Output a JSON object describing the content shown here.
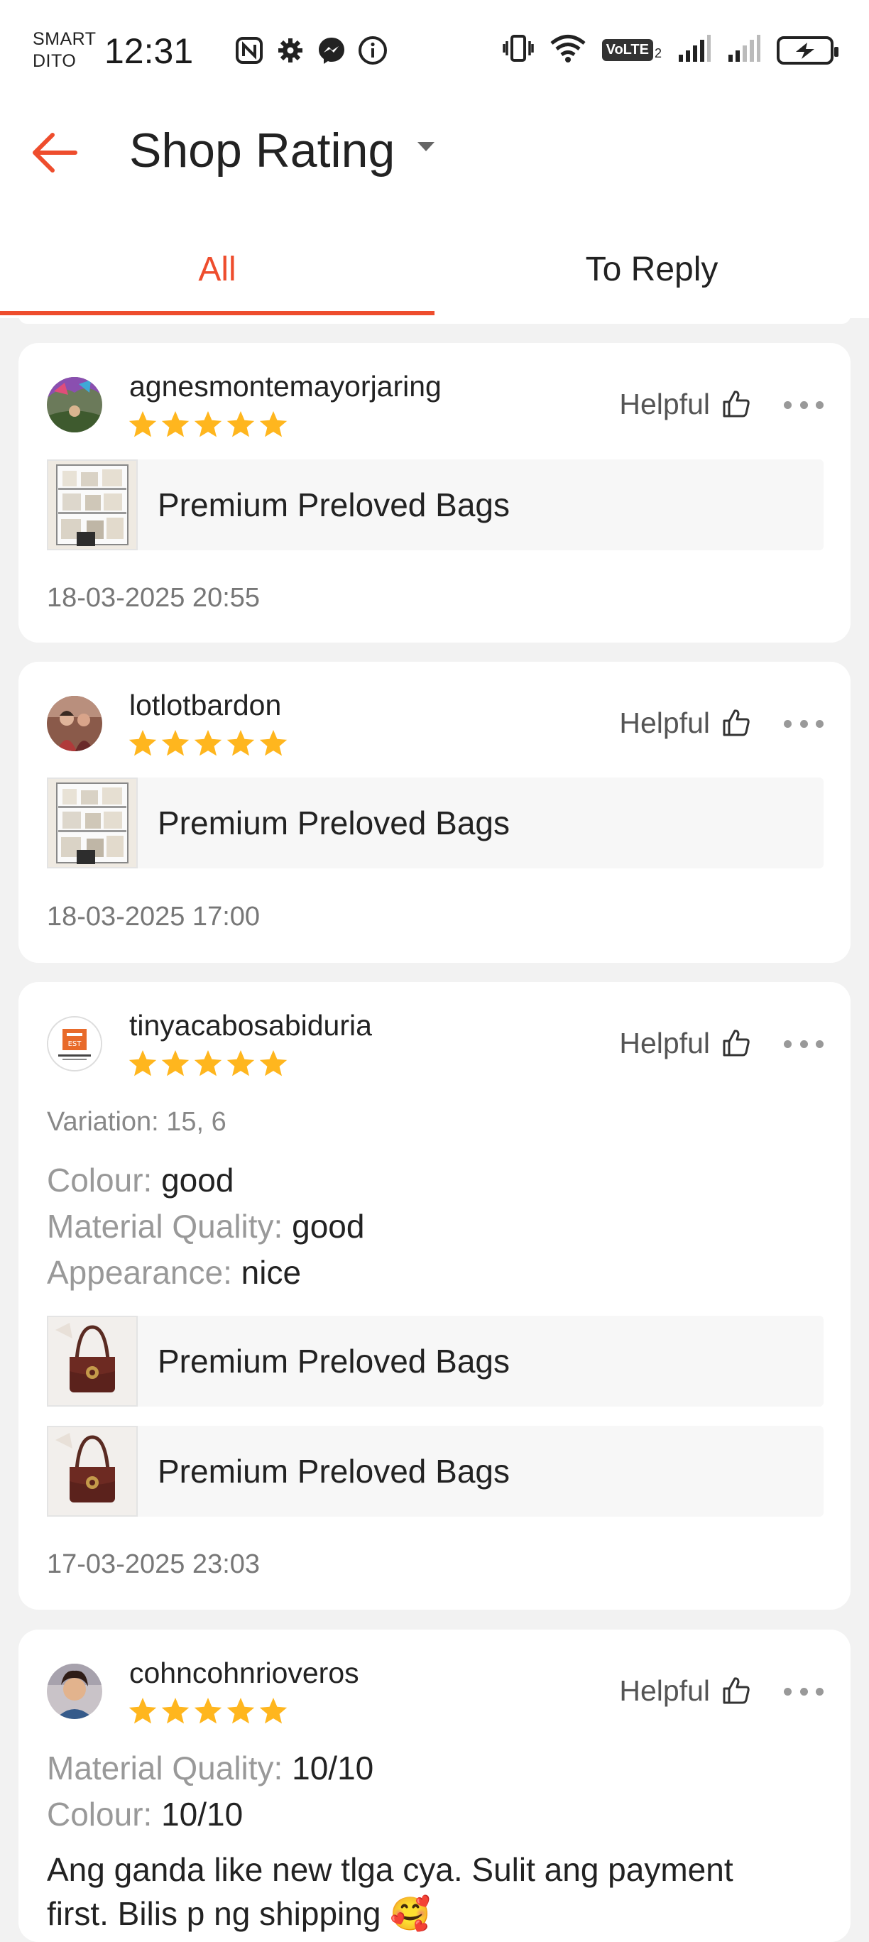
{
  "status_bar": {
    "carrier_line1": "SMART",
    "carrier_line2": "DITO",
    "time": "12:31",
    "volte": "VoLTE",
    "icons": [
      "nfc-icon",
      "gear-icon",
      "messenger-icon",
      "info-icon",
      "vibrate-icon",
      "wifi-icon",
      "volte-icon",
      "signal-icon",
      "signal-icon",
      "battery-charging-icon"
    ]
  },
  "header": {
    "title": "Shop Rating",
    "back_icon": "arrow-left-icon",
    "dropdown_icon": "caret-down-icon"
  },
  "tabs": [
    {
      "label": "All",
      "active": true
    },
    {
      "label": "To Reply",
      "active": false
    }
  ],
  "colors": {
    "accent": "#ee4d2d",
    "star": "#ffb61e",
    "background": "#f2f2f2"
  },
  "reviews": [
    {
      "username": "agnesmontemayorjaring",
      "rating": 5,
      "helpful_label": "Helpful",
      "products": [
        {
          "name": "Premium Preloved Bags"
        }
      ],
      "date": "18-03-2025 20:55"
    },
    {
      "username": "lotlotbardon",
      "rating": 5,
      "helpful_label": "Helpful",
      "products": [
        {
          "name": "Premium Preloved Bags"
        }
      ],
      "date": "18-03-2025 17:00"
    },
    {
      "username": "tinyacabosabiduria",
      "rating": 5,
      "helpful_label": "Helpful",
      "variation": "Variation: 15, 6",
      "attributes": [
        {
          "key": "Colour:",
          "value": "good"
        },
        {
          "key": "Material Quality:",
          "value": "good"
        },
        {
          "key": "Appearance:",
          "value": "nice"
        }
      ],
      "products": [
        {
          "name": "Premium Preloved Bags"
        },
        {
          "name": "Premium Preloved Bags"
        }
      ],
      "date": "17-03-2025 23:03"
    },
    {
      "username": "cohncohnrioveros",
      "rating": 5,
      "helpful_label": "Helpful",
      "attributes": [
        {
          "key": "Material Quality:",
          "value": "10/10"
        },
        {
          "key": "Colour:",
          "value": "10/10"
        }
      ],
      "comment_line1": "Ang ganda like new tlga cya.  Sulit ang payment",
      "comment_line2": "first. Bilis p ng shipping 🥰"
    }
  ]
}
